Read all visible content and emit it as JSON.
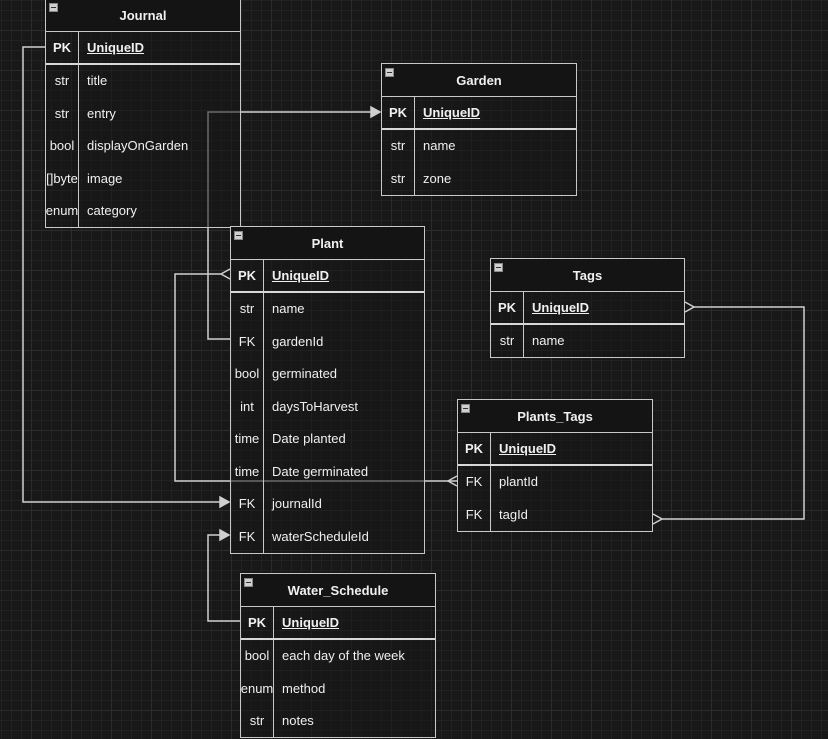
{
  "tables": [
    {
      "name": "Journal",
      "rows": [
        {
          "key": "PK",
          "field": "UniqueID"
        },
        {
          "key": "str",
          "field": "title"
        },
        {
          "key": "str",
          "field": "entry"
        },
        {
          "key": "bool",
          "field": "displayOnGarden"
        },
        {
          "key": "[]byte",
          "field": "image"
        },
        {
          "key": "enum",
          "field": "category"
        }
      ]
    },
    {
      "name": "Garden",
      "rows": [
        {
          "key": "PK",
          "field": "UniqueID"
        },
        {
          "key": "str",
          "field": "name"
        },
        {
          "key": "str",
          "field": "zone"
        }
      ]
    },
    {
      "name": "Plant",
      "rows": [
        {
          "key": "PK",
          "field": "UniqueID"
        },
        {
          "key": "str",
          "field": "name"
        },
        {
          "key": "FK",
          "field": "gardenId"
        },
        {
          "key": "bool",
          "field": "germinated"
        },
        {
          "key": "int",
          "field": "daysToHarvest"
        },
        {
          "key": "time",
          "field": "Date planted"
        },
        {
          "key": "time",
          "field": "Date germinated"
        },
        {
          "key": "FK",
          "field": "journalId"
        },
        {
          "key": "FK",
          "field": "waterScheduleId"
        }
      ]
    },
    {
      "name": "Tags",
      "rows": [
        {
          "key": "PK",
          "field": "UniqueID"
        },
        {
          "key": "str",
          "field": "name"
        }
      ]
    },
    {
      "name": "Plants_Tags",
      "rows": [
        {
          "key": "PK",
          "field": "UniqueID"
        },
        {
          "key": "FK",
          "field": "plantId"
        },
        {
          "key": "FK",
          "field": "tagId"
        }
      ]
    },
    {
      "name": "Water_Schedule",
      "rows": [
        {
          "key": "PK",
          "field": "UniqueID"
        },
        {
          "key": "bool",
          "field": "each day of the week"
        },
        {
          "key": "enum",
          "field": "method"
        },
        {
          "key": "str",
          "field": "notes"
        }
      ]
    }
  ],
  "relationships": [
    {
      "from": "Journal.UniqueID",
      "to": "Plant.journalId",
      "end": "arrow"
    },
    {
      "from": "Plant.gardenId",
      "to": "Garden.UniqueID",
      "end": "arrow"
    },
    {
      "from": "Plant.UniqueID",
      "to": "Plants_Tags.plantId",
      "end": "many-to-many"
    },
    {
      "from": "Tags.UniqueID",
      "to": "Plants_Tags.tagId",
      "end": "many-to-many"
    },
    {
      "from": "Water_Schedule.UniqueID",
      "to": "Plant.waterScheduleId",
      "end": "arrow"
    }
  ],
  "colors": {
    "background": "#181818",
    "line": "#c8c8c8",
    "text": "#f0f0f0"
  }
}
